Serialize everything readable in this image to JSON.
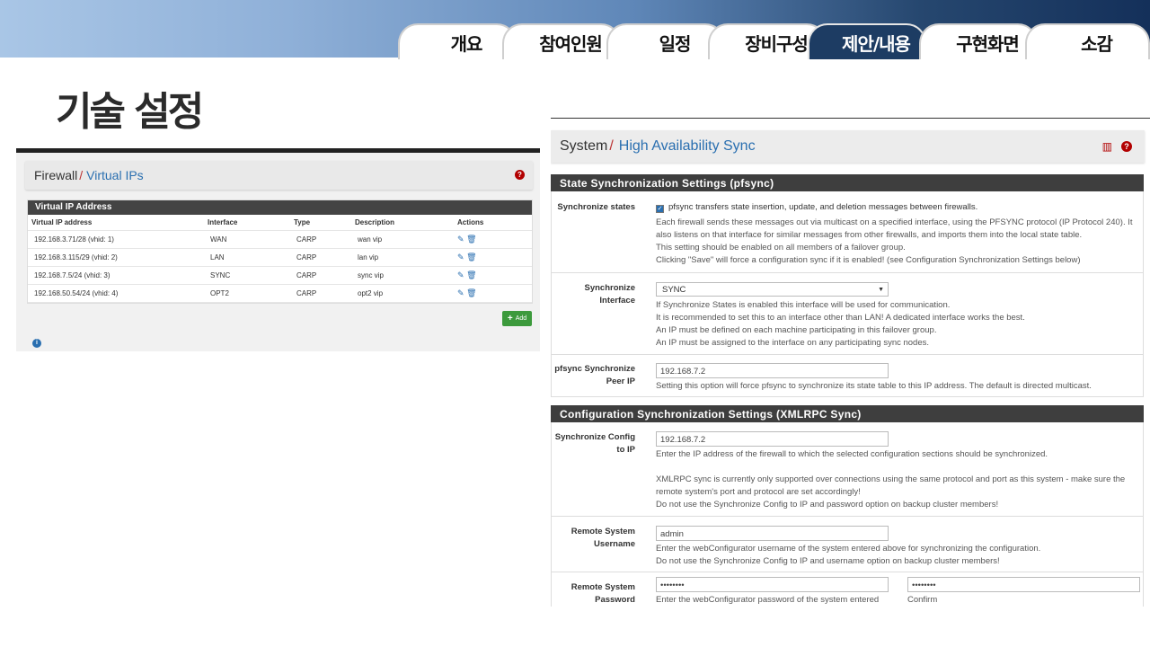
{
  "slide": {
    "tabs": [
      {
        "label": "개요",
        "active": false
      },
      {
        "label": "참여인원",
        "active": false
      },
      {
        "label": "일정",
        "active": false
      },
      {
        "label": "장비구성",
        "active": false
      },
      {
        "label": "제안/내용",
        "active": true
      },
      {
        "label": "구현화면",
        "active": false
      },
      {
        "label": "소감",
        "active": false
      }
    ],
    "title": "기술 설정",
    "colors": {
      "active_tab": "#1d3c63",
      "banner_start": "#a9c6e6",
      "banner_end": "#14305a"
    }
  },
  "vip_panel": {
    "breadcrumb_root": "Firewall",
    "breadcrumb_sep": "/",
    "breadcrumb_leaf": "Virtual IPs",
    "help_icon": "question-circle-icon",
    "table_title": "Virtual IP Address",
    "columns": [
      "Virtual IP address",
      "Interface",
      "Type",
      "Description",
      "Actions"
    ],
    "rows": [
      {
        "address": "192.168.3.71/28 (vhid: 1)",
        "interface": "WAN",
        "type": "CARP",
        "description": "wan vip"
      },
      {
        "address": "192.168.3.115/29 (vhid: 2)",
        "interface": "LAN",
        "type": "CARP",
        "description": "lan vip"
      },
      {
        "address": "192.168.7.5/24 (vhid: 3)",
        "interface": "SYNC",
        "type": "CARP",
        "description": "sync vip"
      },
      {
        "address": "192.168.50.54/24 (vhid: 4)",
        "interface": "OPT2",
        "type": "CARP",
        "description": "opt2 vip"
      }
    ],
    "action_icons": [
      "pencil-icon",
      "trash-icon"
    ],
    "add_label": "Add",
    "info_icon": "info-circle-icon"
  },
  "ha_panel": {
    "breadcrumb_root": "System",
    "breadcrumb_sep": "/",
    "breadcrumb_leaf": "High Availability Sync",
    "section1": "State Synchronization Settings (pfsync)",
    "sync_states": {
      "label": "Synchronize states",
      "checked": true,
      "checkbox_text": "pfsync transfers state insertion, update, and deletion messages between firewalls.",
      "help1": "Each firewall sends these messages out via multicast on a specified interface, using the PFSYNC protocol (IP Protocol 240). It also listens on that interface for similar messages from other firewalls, and imports them into the local state table.",
      "help2": "This setting should be enabled on all members of a failover group.",
      "help3": "Clicking \"Save\" will force a configuration sync if it is enabled! (see Configuration Synchronization Settings below)"
    },
    "sync_interface": {
      "label_line1": "Synchronize",
      "label_line2": "Interface",
      "value": "SYNC",
      "help1": "If Synchronize States is enabled this interface will be used for communication.",
      "help2": "It is recommended to set this to an interface other than LAN! A dedicated interface works the best.",
      "help3": "An IP must be defined on each machine participating in this failover group.",
      "help4": "An IP must be assigned to the interface on any participating sync nodes."
    },
    "peer_ip": {
      "label_line1": "pfsync Synchronize",
      "label_line2": "Peer IP",
      "value": "192.168.7.2",
      "help": "Setting this option will force pfsync to synchronize its state table to this IP address. The default is directed multicast."
    },
    "section2": "Configuration Synchronization Settings (XMLRPC Sync)",
    "config_ip": {
      "label_line1": "Synchronize Config",
      "label_line2": "to IP",
      "value": "192.168.7.2",
      "help1": "Enter the IP address of the firewall to which the selected configuration sections should be synchronized.",
      "help2": "XMLRPC sync is currently only supported over connections using the same protocol and port as this system - make sure the remote system's port and protocol are set accordingly!",
      "help3": "Do not use the Synchronize Config to IP and password option on backup cluster members!"
    },
    "remote_user": {
      "label_line1": "Remote System",
      "label_line2": "Username",
      "value": "admin",
      "help1": "Enter the webConfigurator username of the system entered above for synchronizing the configuration.",
      "help2": "Do not use the Synchronize Config to IP and username option on backup cluster members!"
    },
    "remote_pass": {
      "label_line1": "Remote System",
      "label_line2": "Password",
      "value": "••••••••",
      "confirm_value": "••••••••",
      "help": "Enter the webConfigurator password of the system entered",
      "confirm_label": "Confirm"
    }
  }
}
